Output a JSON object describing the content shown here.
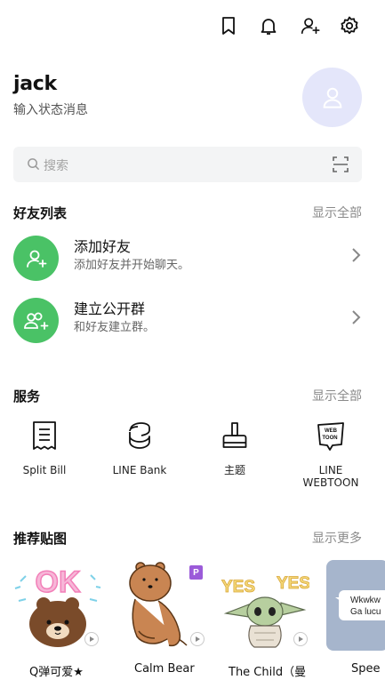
{
  "toolbar": {
    "icons": [
      "bookmark-icon",
      "bell-icon",
      "add-friend-icon",
      "gear-icon"
    ]
  },
  "profile": {
    "name": "jack",
    "status_placeholder": "输入状态消息"
  },
  "search": {
    "placeholder": "搜索"
  },
  "friends": {
    "title": "好友列表",
    "more": "显示全部",
    "items": [
      {
        "title": "添加好友",
        "subtitle": "添加好友并开始聊天。",
        "icon": "add-friend-icon"
      },
      {
        "title": "建立公开群",
        "subtitle": "和好友建立群。",
        "icon": "create-group-icon"
      }
    ]
  },
  "services": {
    "title": "服务",
    "more": "显示全部",
    "items": [
      {
        "label": "Split Bill",
        "icon": "receipt-icon"
      },
      {
        "label": "LINE Bank",
        "icon": "line-bank-icon"
      },
      {
        "label": "主题",
        "icon": "brush-icon"
      },
      {
        "label": "LINE\nWEBTOON",
        "icon": "webtoon-icon"
      }
    ]
  },
  "stickers": {
    "title": "推荐贴图",
    "more": "显示更多",
    "items": [
      {
        "label": "Q弹可爱★",
        "art_text": "OK"
      },
      {
        "label": "Calm Bear",
        "badge": "P"
      },
      {
        "label": "The Child（曼",
        "art_text": "YES"
      },
      {
        "label": "Spee",
        "art_text": "Wkwkw\nGa lucu"
      }
    ]
  },
  "colors": {
    "accent_green": "#4ac266",
    "avatar_bg": "#e4e6fa",
    "search_bg": "#f3f4f5"
  }
}
